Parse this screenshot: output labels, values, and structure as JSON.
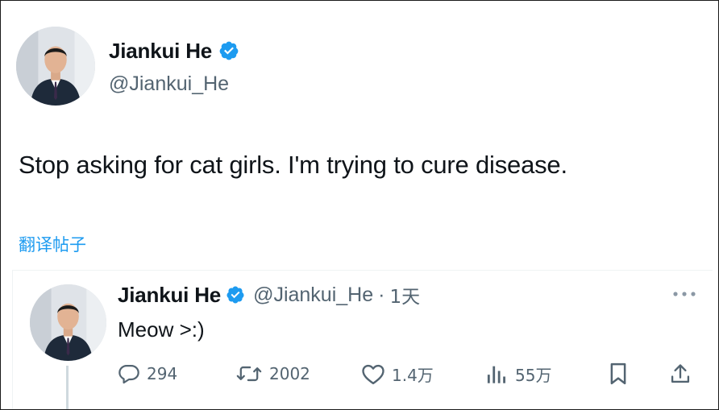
{
  "post": {
    "author": {
      "name": "Jiankui He",
      "handle": "@Jiankui_He",
      "verified_icon": "verified-badge-icon",
      "verified_color": "#1d9bf0"
    },
    "text": "Stop asking for cat girls. I'm trying to cure disease.",
    "translate_label": "翻译帖子"
  },
  "reply": {
    "author": {
      "name": "Jiankui He",
      "handle": "@Jiankui_He",
      "verified_icon": "verified-badge-icon"
    },
    "separator": "·",
    "time": "1天",
    "text": "Meow >:)",
    "more_icon": "more-horizontal-icon",
    "actions": {
      "reply": {
        "icon": "reply-icon",
        "count": "294"
      },
      "retweet": {
        "icon": "retweet-icon",
        "count": "2002"
      },
      "like": {
        "icon": "heart-icon",
        "count": "1.4万"
      },
      "views": {
        "icon": "views-chart-icon",
        "count": "55万"
      },
      "bookmark": {
        "icon": "bookmark-icon"
      },
      "share": {
        "icon": "share-icon"
      }
    }
  },
  "colors": {
    "text_primary": "#0f1419",
    "text_secondary": "#536471",
    "link": "#1d9bf0",
    "border": "#eff3f4"
  }
}
